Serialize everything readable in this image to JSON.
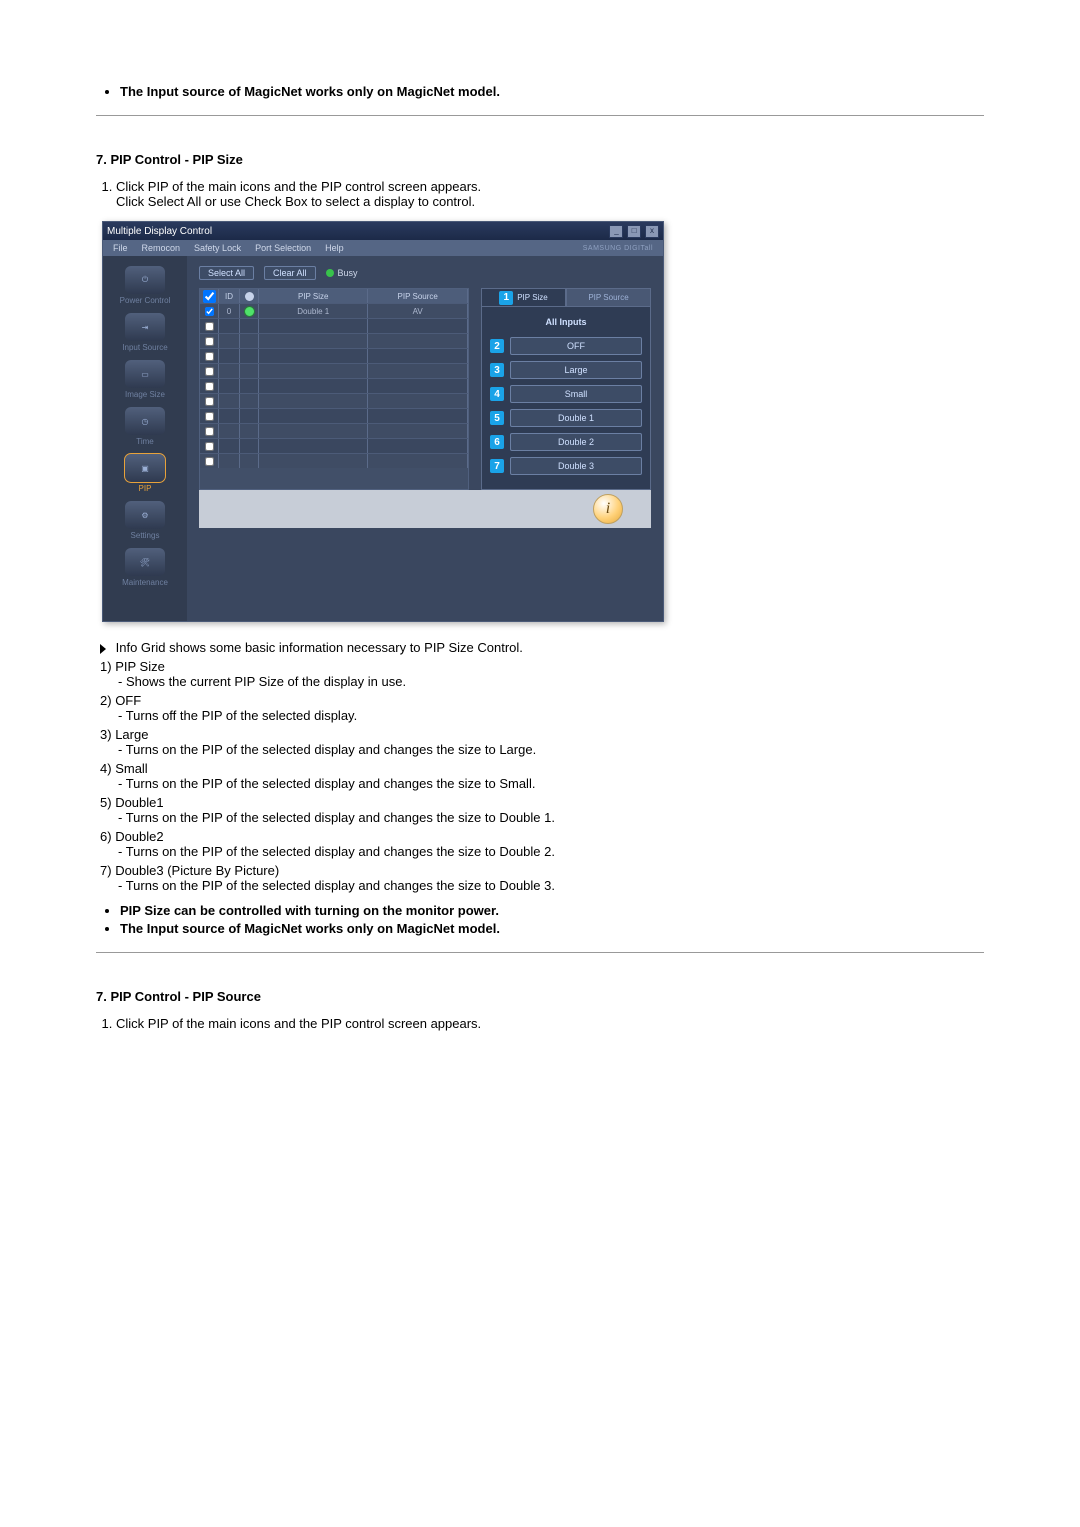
{
  "top_note": "The Input source of MagicNet works only on MagicNet model.",
  "section1": {
    "heading": "7. PIP Control - PIP Size",
    "step1a": "Click PIP of the main icons and the PIP control screen appears.",
    "step1b": "Click Select All or use Check Box to select a display to control."
  },
  "mdc": {
    "title": "Multiple Display Control",
    "menu": [
      "File",
      "Remocon",
      "Safety Lock",
      "Port Selection",
      "Help"
    ],
    "brand": "SAMSUNG DIGITall",
    "sidebar": [
      {
        "label": "Power Control"
      },
      {
        "label": "Input Source"
      },
      {
        "label": "Image Size"
      },
      {
        "label": "Time"
      },
      {
        "label": "PIP"
      },
      {
        "label": "Settings"
      },
      {
        "label": "Maintenance"
      }
    ],
    "toolbar": {
      "select_all": "Select All",
      "clear_all": "Clear All",
      "busy": "Busy"
    },
    "grid_head": {
      "id": "ID",
      "pip_size": "PIP Size",
      "pip_source": "PIP Source"
    },
    "grid_row0": {
      "id": "0",
      "pip_size": "Double 1",
      "pip_source": "AV"
    },
    "panel": {
      "tab_size": "PIP Size",
      "tab_source": "PIP Source",
      "header": "All Inputs",
      "buttons": [
        "OFF",
        "Large",
        "Small",
        "Double 1",
        "Double 2",
        "Double 3"
      ]
    }
  },
  "info_grid": "Info Grid shows some basic information necessary to PIP Size Control.",
  "items": [
    {
      "n": "1)",
      "label": "PIP Size",
      "desc": "- Shows the current PIP Size of the display in use."
    },
    {
      "n": "2)",
      "label": "OFF",
      "desc": "- Turns off the PIP of the selected display."
    },
    {
      "n": "3)",
      "label": "Large",
      "desc": "- Turns on the PIP of the selected display and changes the size to Large."
    },
    {
      "n": "4)",
      "label": "Small",
      "desc": "- Turns on the PIP of the selected display and changes the size to Small."
    },
    {
      "n": "5)",
      "label": "Double1",
      "desc": "- Turns on the PIP of the selected display and changes the size to Double 1."
    },
    {
      "n": "6)",
      "label": "Double2",
      "desc": "- Turns on the PIP of the selected display and changes the size to Double 2."
    },
    {
      "n": "7)",
      "label": "Double3 (Picture By Picture)",
      "desc": "- Turns on the PIP of the selected display and changes the size to Double 3."
    }
  ],
  "notes2": [
    "PIP Size can be controlled with turning on the monitor power.",
    "The Input source of MagicNet works only on MagicNet model."
  ],
  "section2": {
    "heading": "7. PIP Control - PIP Source",
    "step1": "Click PIP of the main icons and the PIP control screen appears."
  }
}
